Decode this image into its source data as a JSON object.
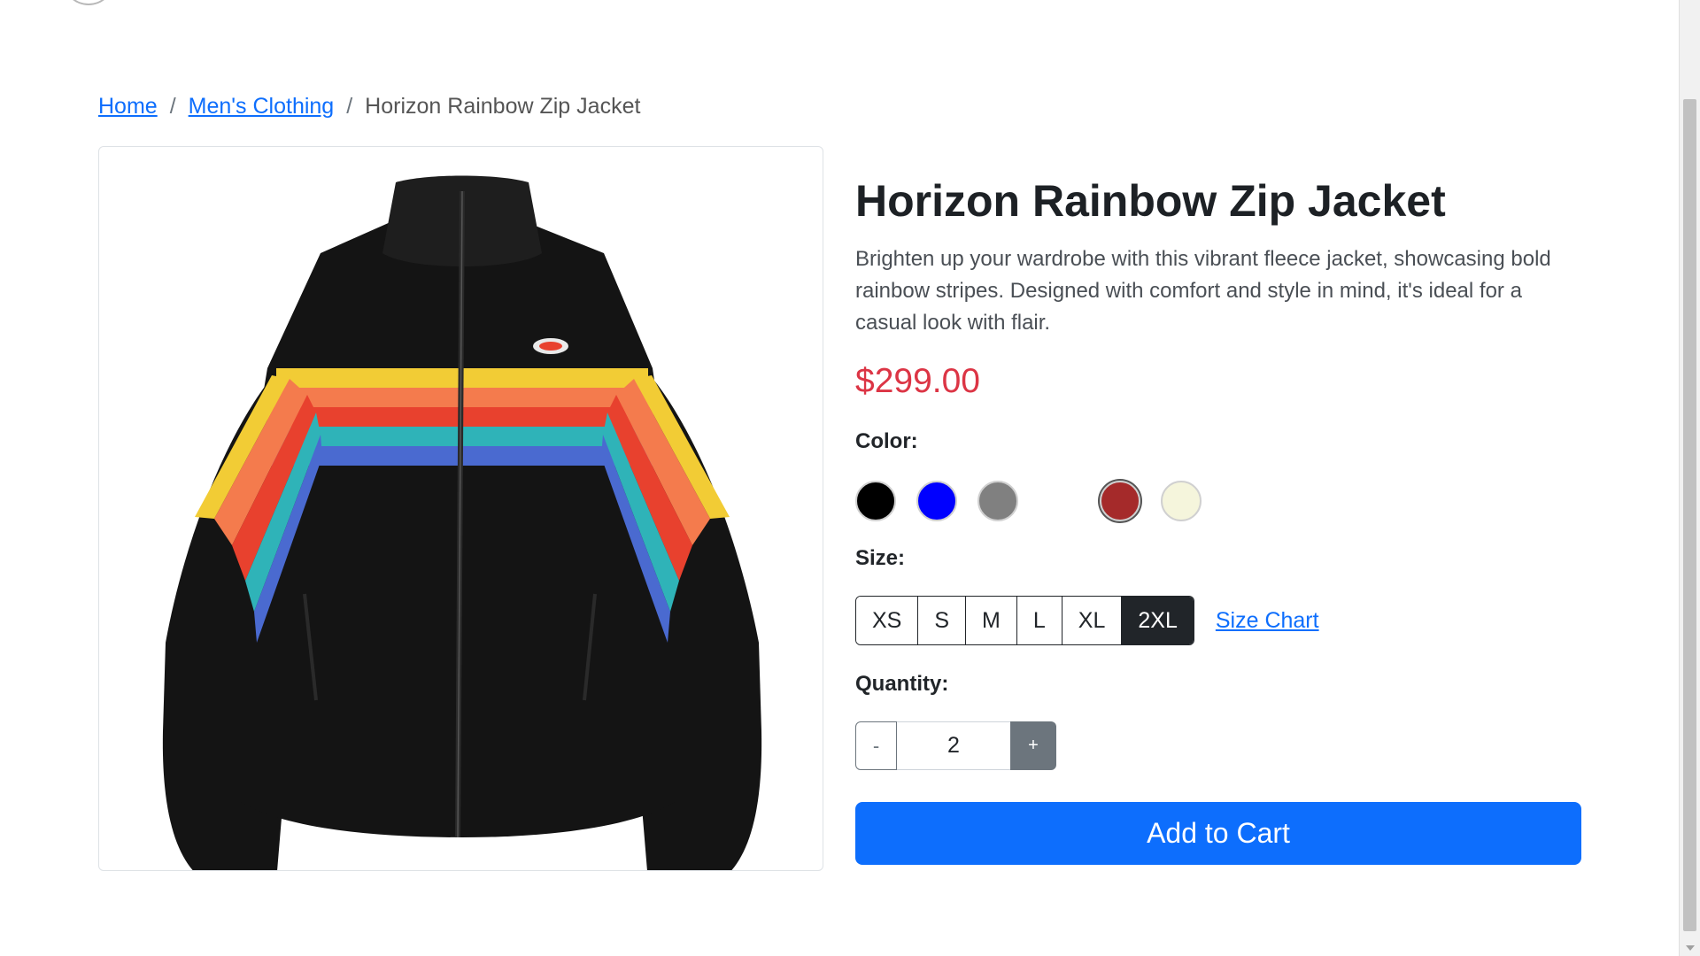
{
  "breadcrumb": {
    "home": "Home",
    "category": "Men's Clothing",
    "current": "Horizon Rainbow Zip Jacket",
    "separator": "/"
  },
  "product": {
    "title": "Horizon Rainbow Zip Jacket",
    "description": "Brighten up your wardrobe with this vibrant fleece jacket, showcasing bold rainbow stripes. Designed with comfort and style in mind, it's ideal for a casual look with flair.",
    "price": "$299.00",
    "image_icon": "jacket-image"
  },
  "color": {
    "label": "Color:",
    "swatches": [
      "#000000",
      "#0000ff",
      "#808080",
      "#ffffff",
      "#a52a2a",
      "#f5f5dc"
    ]
  },
  "size": {
    "label": "Size:",
    "options": [
      "XS",
      "S",
      "M",
      "L",
      "XL",
      "2XL"
    ],
    "selected": "2XL",
    "chart_link": "Size Chart"
  },
  "quantity": {
    "label": "Quantity:",
    "value": "2",
    "minus": "-",
    "plus": "+"
  },
  "cart": {
    "add_label": "Add to Cart"
  },
  "theme": {
    "accent": "#0d6efd",
    "price_color": "#dc3545"
  }
}
